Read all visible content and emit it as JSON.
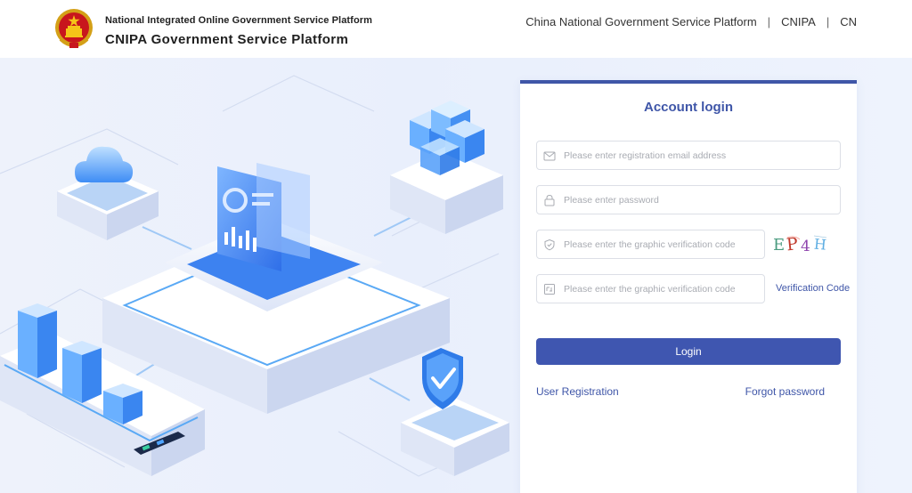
{
  "header": {
    "line1": "National Integrated Online Government Service Platform",
    "line2": "CNIPA Government Service Platform",
    "nav": {
      "item1": "China National Government Service Platform",
      "separator": "|",
      "item2": "CNIPA",
      "item3": "CN"
    }
  },
  "login": {
    "title": "Account login",
    "email_placeholder": "Please enter registration email address",
    "password_placeholder": "Please enter password",
    "captcha_placeholder": "Please enter the graphic verification code",
    "code_placeholder": "Please enter the graphic verification code",
    "captcha_text": "EP4H",
    "send_code_label": "Verification Code",
    "login_label": "Login",
    "register_label": "User Registration",
    "forgot_label": "Forgot password"
  },
  "colors": {
    "accent": "#3f56a8",
    "button": "#3f56b0",
    "background": "#eef2fb"
  },
  "icons": [
    "national-emblem-icon",
    "email-icon",
    "lock-icon",
    "shield-icon",
    "verification-icon"
  ]
}
